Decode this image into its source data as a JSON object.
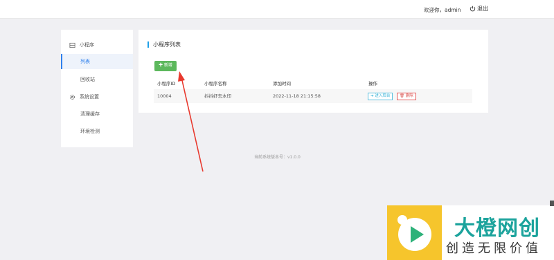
{
  "header": {
    "welcome_text": "欢迎你，admin",
    "logout_label": "退出",
    "logout_icon": "power-icon"
  },
  "sidebar": {
    "groups": [
      {
        "label": "小程序",
        "icon": "miniprogram-icon",
        "items": [
          {
            "label": "列表",
            "active": true
          },
          {
            "label": "回收站",
            "active": false
          }
        ]
      },
      {
        "label": "系统设置",
        "icon": "gear-icon",
        "items": [
          {
            "label": "清理缓存",
            "active": false
          },
          {
            "label": "环境检测",
            "active": false
          }
        ]
      }
    ]
  },
  "main": {
    "title": "小程序列表",
    "add_button_label": "✚ 新增",
    "table": {
      "columns": [
        "小程序ID",
        "小程序名称",
        "添加时间",
        "操作"
      ],
      "rows": [
        {
          "id": "10004",
          "name": "抖抖虾去水印",
          "added": "2022-11-18 21:15:58",
          "actions": {
            "enter_label": "➜ 进入后台",
            "delete_label": "🗑 删除"
          }
        }
      ]
    }
  },
  "footer": {
    "version": "当前系统版本号：v1.0.0"
  },
  "watermark": {
    "name": "大橙网创",
    "slogan": "创造无限价值"
  },
  "colors": {
    "accent": "#2f80ed",
    "title_bar": "#1ea0e8",
    "add_button": "#5cb85c",
    "enter_button": "#31b0d5",
    "delete_button": "#d9534f",
    "arrow": "#e8392e",
    "watermark_brand": "#1ba39c",
    "watermark_logo": "#f6c52c"
  }
}
